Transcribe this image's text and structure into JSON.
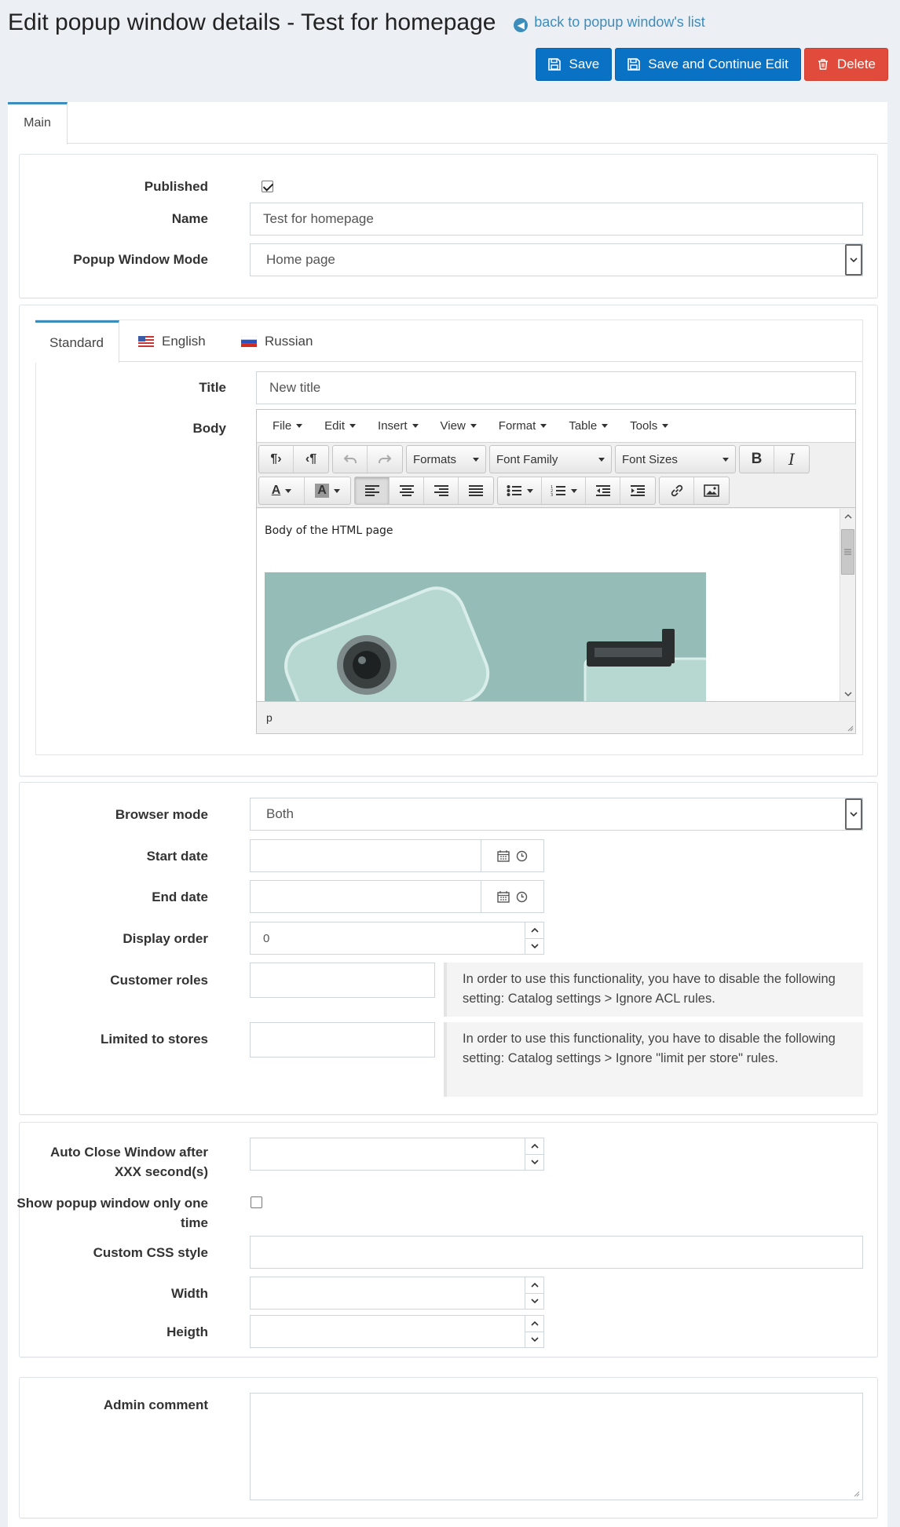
{
  "header": {
    "title": "Edit popup window details - Test for homepage",
    "back_link": "back to popup window's list"
  },
  "actions": {
    "save": "Save",
    "save_continue": "Save and Continue Edit",
    "delete": "Delete"
  },
  "main_tab": "Main",
  "general": {
    "published_label": "Published",
    "published": true,
    "name_label": "Name",
    "name_value": "Test for homepage",
    "mode_label": "Popup Window Mode",
    "mode_value": "Home page"
  },
  "localized": {
    "tabs": [
      {
        "label": "Standard"
      },
      {
        "label": "English"
      },
      {
        "label": "Russian"
      }
    ],
    "title_label": "Title",
    "title_value": "New title",
    "body_label": "Body",
    "editor": {
      "menu": [
        "File",
        "Edit",
        "Insert",
        "View",
        "Format",
        "Table",
        "Tools"
      ],
      "formats": "Formats",
      "font_family": "Font Family",
      "font_sizes": "Font Sizes",
      "content_text": "Body of the HTML page",
      "status_path": "p"
    }
  },
  "schedule": {
    "browser_label": "Browser mode",
    "browser_value": "Both",
    "start_label": "Start date",
    "end_label": "End date",
    "order_label": "Display order",
    "order_value": "0",
    "roles_label": "Customer roles",
    "roles_note": "In order to use this functionality, you have to disable the following setting: Catalog settings > Ignore ACL rules.",
    "stores_label": "Limited to stores",
    "stores_note": "In order to use this functionality, you have to disable the following setting: Catalog settings > Ignore \"limit per store\" rules."
  },
  "behavior": {
    "autoclose_label": "Auto Close Window after XXX second(s)",
    "show_once_label": "Show popup window only one time",
    "show_once": false,
    "css_label": "Custom CSS style",
    "width_label": "Width",
    "height_label": "Heigth"
  },
  "admin": {
    "comment_label": "Admin comment"
  }
}
